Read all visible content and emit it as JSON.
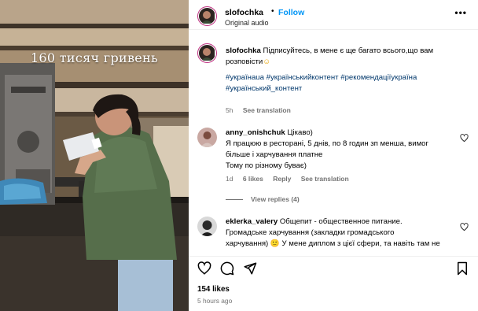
{
  "media": {
    "overlay_text": "160 тисяч гривень"
  },
  "header": {
    "username": "slofochka",
    "separator": "•",
    "follow_label": "Follow",
    "subtitle": "Original audio",
    "more_glyph": "•••"
  },
  "caption": {
    "username": "slofochka",
    "text": "Підписуйтесь, в мене є ще багато всього,що вам розповісти",
    "emoji": "☺",
    "hashtags": "#українаua #українськийконтент #рекомендаціїукраїна #український_контент",
    "age": "5h",
    "see_translation": "See translation"
  },
  "comments": [
    {
      "username": "anny_onishchuk",
      "first_line": "Цікаво)",
      "lines": [
        "Я працюю в ресторані, 5 днів, по 8 годин зп менша, вимог",
        "більше і харчування платне",
        "Тому по різному буває)"
      ],
      "age": "1d",
      "likes": "6 likes",
      "reply": "Reply",
      "see_translation": "See translation",
      "view_replies": "View replies (4)"
    },
    {
      "username": "eklerka_valery",
      "first_line": "Общепит - общественное питание.",
      "lines": [
        "Громадське харчування (закладки громадського",
        "харчування) 🙂 У мене диплом з цієї сфери, та навіть там не"
      ]
    }
  ],
  "actions": {
    "likes": "154 likes",
    "time": "5 hours ago",
    "icons": [
      "heart-icon",
      "comment-icon",
      "share-icon",
      "bookmark-icon"
    ]
  },
  "colors": {
    "follow": "#0095f6",
    "hashtag": "#00376b",
    "muted": "#737373"
  }
}
